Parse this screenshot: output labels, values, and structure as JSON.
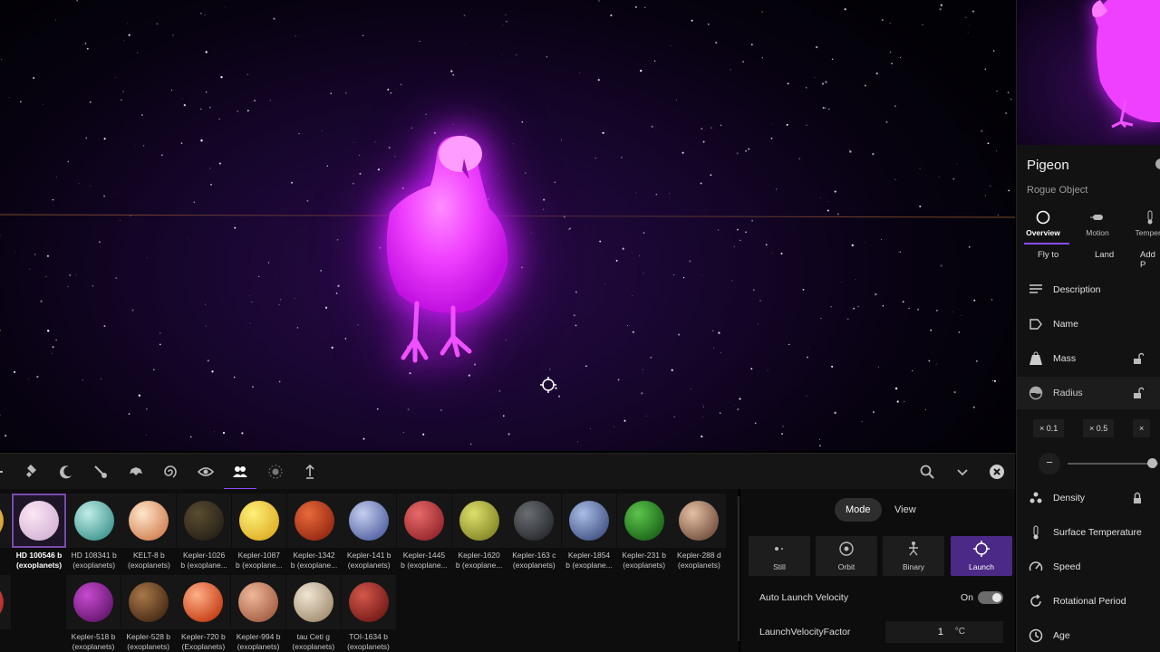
{
  "sidebar": {
    "object_name": "Pigeon",
    "object_type": "Rogue Object",
    "tabs": [
      {
        "label": "Overview",
        "icon": "circle-icon"
      },
      {
        "label": "Motion",
        "icon": "motion-icon"
      },
      {
        "label": "Tempera",
        "icon": "thermometer-icon"
      }
    ],
    "actions": [
      "Fly to",
      "Land",
      "Add P"
    ],
    "properties": [
      {
        "label": "Description",
        "icon": "description-icon"
      },
      {
        "label": "Name",
        "icon": "tag-icon"
      },
      {
        "label": "Mass",
        "icon": "weight-icon"
      },
      {
        "label": "Radius",
        "icon": "radius-icon"
      },
      {
        "label": "Density",
        "icon": "density-icon"
      },
      {
        "label": "Surface Temperature",
        "icon": "thermometer-icon"
      },
      {
        "label": "Speed",
        "icon": "speedometer-icon"
      },
      {
        "label": "Rotational Period",
        "icon": "rotation-icon"
      },
      {
        "label": "Age",
        "icon": "clock-icon"
      }
    ],
    "radius_multipliers": [
      "× 0.1",
      "× 0.5",
      "×"
    ],
    "slider_minus": "−"
  },
  "launch_panel": {
    "segments": [
      "Mode",
      "View"
    ],
    "modes": [
      {
        "label": "Still",
        "icon": "still-icon"
      },
      {
        "label": "Orbit",
        "icon": "orbit-icon"
      },
      {
        "label": "Binary",
        "icon": "binary-icon"
      },
      {
        "label": "Launch",
        "icon": "crosshair-icon"
      }
    ],
    "auto_launch_label": "Auto Launch Velocity",
    "auto_launch_state": "On",
    "factor_label": "LaunchVelocityFactor",
    "factor_value": "1",
    "factor_unit": "°C"
  },
  "browser": {
    "row1": [
      {
        "name": "HD 100546 b",
        "src": "(exoplanets)",
        "colors": [
          "#fbe7f4",
          "#d7b6d8"
        ]
      },
      {
        "name": "HD 108341 b",
        "src": "(exoplanets)",
        "colors": [
          "#bfeee6",
          "#4a9c96"
        ]
      },
      {
        "name": "KELT-8 b",
        "src": "(exoplanets)",
        "colors": [
          "#ffe6cc",
          "#d4885a"
        ]
      },
      {
        "name": "Kepler-1026",
        "src": "b (exoplane...",
        "colors": [
          "#5a4d32",
          "#2a2418"
        ]
      },
      {
        "name": "Kepler-1087",
        "src": "b (exoplane...",
        "colors": [
          "#fff07a",
          "#e0b22a"
        ]
      },
      {
        "name": "Kepler-1342",
        "src": "b (exoplane...",
        "colors": [
          "#e86a3a",
          "#9a2c14"
        ]
      },
      {
        "name": "Kepler-141 b",
        "src": "(exoplanets)",
        "colors": [
          "#c6cfef",
          "#5a6aa8"
        ]
      },
      {
        "name": "Kepler-1445",
        "src": "b (exoplane...",
        "colors": [
          "#e86a6a",
          "#9a2a30"
        ]
      },
      {
        "name": "Kepler-1620",
        "src": "b (exoplane...",
        "colors": [
          "#dde06a",
          "#8a8c2a"
        ]
      },
      {
        "name": "Kepler-163 c",
        "src": "(exoplanets)",
        "colors": [
          "#6a6e72",
          "#2c2e32"
        ]
      },
      {
        "name": "Kepler-1854",
        "src": "b (exoplane...",
        "colors": [
          "#a9bde8",
          "#4a5c8a"
        ]
      },
      {
        "name": "Kepler-231 b",
        "src": "(exoplanets)",
        "colors": [
          "#5cc44c",
          "#1e6a1a"
        ]
      },
      {
        "name": "Kepler-288 d",
        "src": "(exoplanets)",
        "colors": [
          "#e6c0a4",
          "#7a5846"
        ]
      }
    ],
    "row2": [
      {
        "name": "Kepler-518 b",
        "src": "(exoplanets)",
        "colors": [
          "#c84ad0",
          "#6a1a74"
        ]
      },
      {
        "name": "Kepler-528 b",
        "src": "(exoplanets)",
        "colors": [
          "#a87848",
          "#4e3018"
        ]
      },
      {
        "name": "Kepler-720 b",
        "src": "(Exoplanets)",
        "colors": [
          "#ffb088",
          "#c8441c"
        ]
      },
      {
        "name": "Kepler-994 b",
        "src": "(exoplanets)",
        "colors": [
          "#f0b89a",
          "#a8644a"
        ]
      },
      {
        "name": "tau Ceti g",
        "src": "(exoplanets)",
        "colors": [
          "#f0e6d4",
          "#a89478"
        ]
      },
      {
        "name": "TOI-1634 b",
        "src": "(exoplanets)",
        "colors": [
          "#d4584a",
          "#7a1e1a"
        ]
      }
    ]
  },
  "toolbar": {
    "icons": [
      "satellite-icon",
      "moon-icon",
      "comet-icon",
      "spaceship-icon",
      "spiral-icon",
      "eye-icon",
      "people-icon",
      "sun-icon",
      "launcher-icon"
    ],
    "right_icons": [
      "search-icon",
      "chevron-down-icon",
      "close-icon"
    ]
  },
  "colors": {
    "accent": "#8a4cff",
    "pigeon_glow": "#e020ff"
  }
}
